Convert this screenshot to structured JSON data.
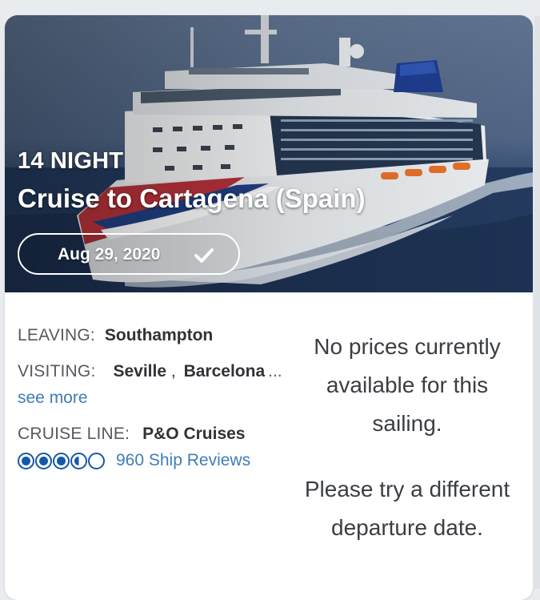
{
  "card": {
    "nights": "14 NIGHT",
    "title": "Cruise to Cartagena (Spain)",
    "date": "Aug 29, 2020",
    "date_icon": "checkmark-icon"
  },
  "details": {
    "leaving_label": "LEAVING:",
    "leaving_value": "Southampton",
    "visiting_label": "VISITING:",
    "visiting_ports": [
      "Seville",
      "Barcelona"
    ],
    "visiting_separator": ",",
    "visiting_ellipsis": "...",
    "see_more": "see more",
    "cruise_line_label": "CRUISE LINE:",
    "cruise_line_value": "P&O Cruises",
    "rating_value": 3.5,
    "rating_max": 5,
    "reviews": "960 Ship Reviews"
  },
  "pricing": {
    "no_prices": "No prices currently available for this sailing.",
    "try_again": "Please try a different departure date."
  },
  "colors": {
    "accent": "#1558a8",
    "link": "#3f7cb7",
    "text": "#2f3337"
  }
}
